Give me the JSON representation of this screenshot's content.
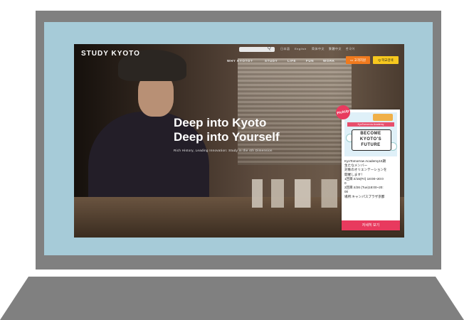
{
  "site": {
    "logo": "STUDY KYOTO",
    "search_icon": "Q",
    "lang_links": [
      "日本語",
      "English",
      "简体中文",
      "繁體中文",
      "한국어"
    ],
    "nav": [
      "WHY KYOTO?",
      "STUDY",
      "LIFE",
      "FUN",
      "WORK"
    ],
    "btn_apply": "▭ 고객지원",
    "btn_search": "Q 학교검색"
  },
  "hero": {
    "title_line1": "Deep into Kyoto",
    "title_line2": "Deep into Yourself",
    "subtitle": "Rich History, Leading Innovation: Study in the 4th Dimension"
  },
  "popup": {
    "badge": "PickUp",
    "ribbon": "KyoTomorrow Academy",
    "image_text_line1": "BECOME",
    "image_text_line2": "KYOTO'S",
    "image_text_line3": "FUTURE",
    "lines": [
      "KyoTomorrow Academy10期",
      "生たなメンバー",
      "対象のオリエンテーションを",
      "開催します！",
      "1回目:4/15(Fri) 18:00~20:0",
      "0",
      "2回目:4/26 (Tue)18:00~20:",
      "00",
      "場所:キャンパスプラザ京都"
    ],
    "button": "자세히 보기"
  },
  "colors": {
    "orange": "#f07a1e",
    "yellow": "#f7c81e",
    "pink": "#e83a5e",
    "screen_bezel": "#a6cbd8",
    "laptop_gray": "#808080"
  }
}
